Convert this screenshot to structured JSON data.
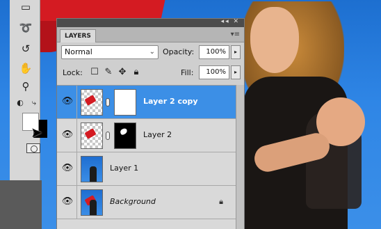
{
  "window": {
    "panel_tab": "LAYERS",
    "panel_menu_icon": "panel-menu-icon"
  },
  "blend": {
    "mode": "Normal",
    "opacity_label": "Opacity:",
    "opacity_value": "100%"
  },
  "lock": {
    "label": "Lock:",
    "fill_label": "Fill:",
    "fill_value": "100%"
  },
  "layers": [
    {
      "name": "Layer 2 copy",
      "selected": true,
      "visible": true,
      "has_mask": true,
      "mask": "white"
    },
    {
      "name": "Layer 2",
      "selected": false,
      "visible": true,
      "has_mask": true,
      "mask": "black"
    },
    {
      "name": "Layer 1",
      "selected": false,
      "visible": true,
      "has_mask": false
    },
    {
      "name": "Background",
      "selected": false,
      "visible": true,
      "has_mask": false,
      "locked": true
    }
  ],
  "tools": [
    "lasso-icon",
    "healing-icon",
    "history-brush-icon",
    "hand-icon",
    "zoom-icon",
    "swap-colors-icon",
    "quick-mask-icon"
  ],
  "colors": {
    "selection": "#3c8fe6",
    "panel_bg": "#cfcfcf",
    "sky": "#2f86e6",
    "cloth": "#d41b22"
  }
}
